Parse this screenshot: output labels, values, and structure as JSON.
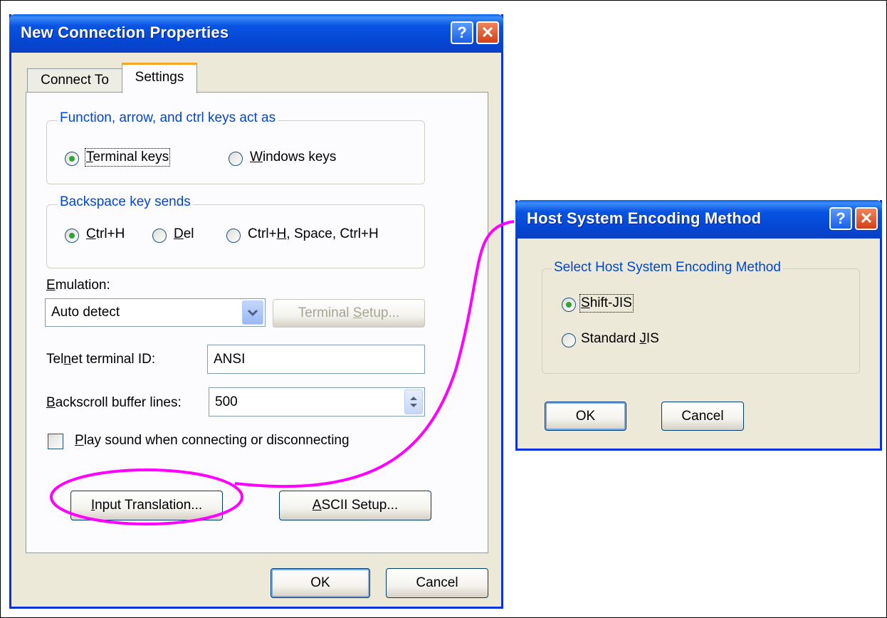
{
  "left_dialog": {
    "title": "New Connection Properties",
    "help_glyph": "?",
    "close_glyph": "✕",
    "tabs": [
      {
        "label": "Connect To",
        "active": false
      },
      {
        "label": "Settings",
        "active": true
      }
    ],
    "keys_group": {
      "label": "Function, arrow, and ctrl keys act as",
      "options": [
        {
          "prefix": "",
          "mnemonic": "T",
          "rest": "erminal keys",
          "checked": true
        },
        {
          "prefix": "",
          "mnemonic": "W",
          "rest": "indows keys",
          "checked": false
        }
      ]
    },
    "backspace_group": {
      "label": "Backspace key sends",
      "options": [
        {
          "prefix": "",
          "mnemonic": "C",
          "rest": "trl+H",
          "checked": true
        },
        {
          "prefix": "",
          "mnemonic": "D",
          "rest": "el",
          "checked": false
        },
        {
          "prefix": "Ctrl+",
          "mnemonic": "H",
          "rest": ", Space, Ctrl+H",
          "checked": false
        }
      ]
    },
    "emulation": {
      "label_mnemonic": "E",
      "label_rest": "mulation:",
      "value": "Auto detect",
      "terminal_setup_prefix": "Terminal ",
      "terminal_setup_mnemonic": "S",
      "terminal_setup_rest": "etup..."
    },
    "telnet": {
      "label_prefix": "Tel",
      "label_mnemonic": "n",
      "label_rest": "et terminal ID:",
      "value": "ANSI"
    },
    "backscroll": {
      "label_mnemonic": "B",
      "label_rest": "ackscroll buffer lines:",
      "value": "500"
    },
    "play_sound": {
      "label_mnemonic": "P",
      "label_rest": "lay sound when connecting or disconnecting",
      "checked": false
    },
    "input_translation": {
      "mnemonic": "I",
      "rest": "nput Translation..."
    },
    "ascii_setup": {
      "mnemonic": "A",
      "rest": "SCII Setup..."
    },
    "ok_label": "OK",
    "cancel_label": "Cancel"
  },
  "right_dialog": {
    "title": "Host System Encoding Method",
    "help_glyph": "?",
    "close_glyph": "✕",
    "group_label": "Select Host System Encoding Method",
    "options": [
      {
        "prefix": "",
        "mnemonic": "S",
        "rest": "hift-JIS",
        "checked": true
      },
      {
        "prefix": "Standard ",
        "mnemonic": "J",
        "rest": "IS",
        "checked": false
      }
    ],
    "ok_label": "OK",
    "cancel_label": "Cancel"
  },
  "annotation_color": "#ff00ff"
}
